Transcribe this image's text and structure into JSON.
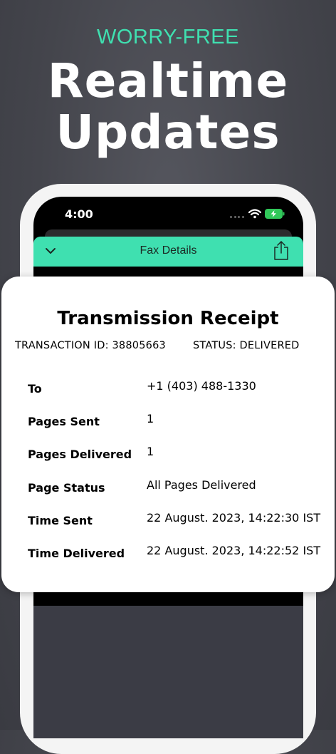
{
  "promo": {
    "eyebrow": "WORRY-FREE",
    "headline_line1": "Realtime",
    "headline_line2": "Updates"
  },
  "status_bar": {
    "time": "4:00",
    "icons": [
      "wifi-icon",
      "battery-charging-icon"
    ]
  },
  "nav": {
    "title": "Fax Details",
    "left_icon": "chevron-down-icon",
    "right_icon": "share-icon",
    "accent_color": "#3fe0b0"
  },
  "receipt": {
    "title": "Transmission Receipt",
    "transaction_id": "TRANSACTION ID: 38805663",
    "status": "STATUS: DELIVERED",
    "rows": [
      {
        "label": "To",
        "value": "+1 (403) 488-1330"
      },
      {
        "label": "Pages Sent",
        "value": "1"
      },
      {
        "label": "Pages Delivered",
        "value": "1"
      },
      {
        "label": "Page Status",
        "value": "All Pages Delivered"
      },
      {
        "label": "Time Sent",
        "value": "22 August. 2023, 14:22:30 IST"
      },
      {
        "label": "Time Delivered",
        "value": "22 August. 2023, 14:22:52 IST"
      }
    ]
  }
}
